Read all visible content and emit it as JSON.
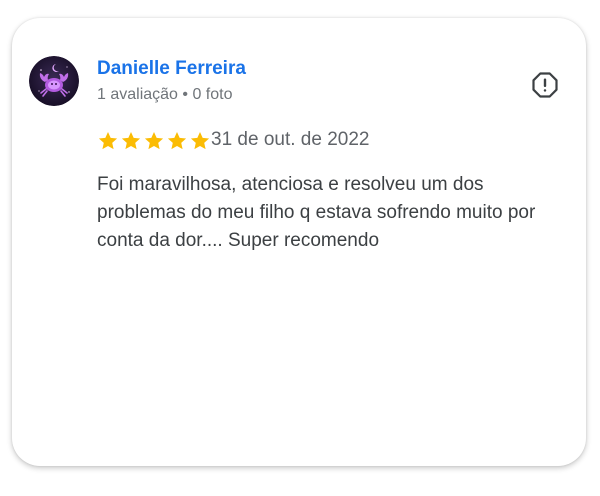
{
  "review": {
    "author_name": "Danielle Ferreira",
    "author_meta": "1 avaliação • 0 foto",
    "rating": 5,
    "rating_max": 5,
    "date": "31 de out. de 2022",
    "text": "Foi maravilhosa, atenciosa e resolveu um dos problemas do meu filho q estava sofrendo muito por conta da dor.... Super recomendo"
  },
  "icons": {
    "avatar": "cancer-zodiac-avatar",
    "report": "report-flag-icon",
    "star": "star-icon"
  },
  "colors": {
    "author_name": "#1a73e8",
    "star_filled": "#fbbc04",
    "text": "#3c4043",
    "meta": "#70757a"
  }
}
